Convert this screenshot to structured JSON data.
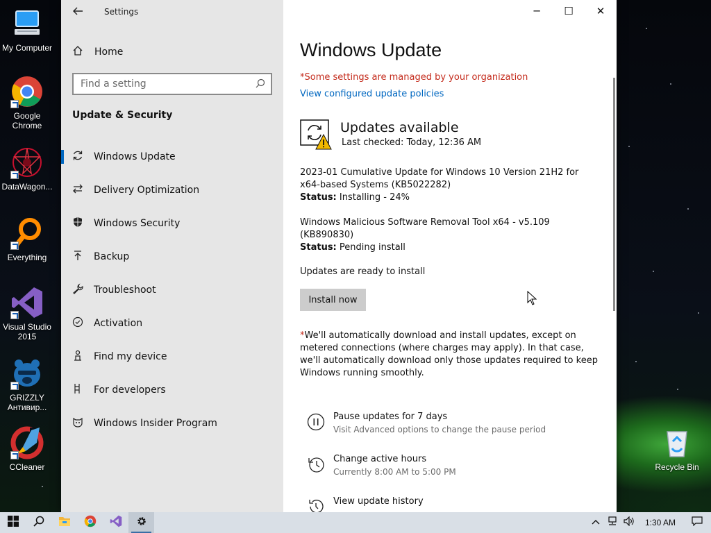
{
  "desktop": {
    "icons": [
      {
        "label": "My Computer",
        "icon": "computer-icon"
      },
      {
        "label": "Google Chrome",
        "icon": "chrome-icon"
      },
      {
        "label": "DataWagon...",
        "icon": "datawagon-icon"
      },
      {
        "label": "Everything",
        "icon": "everything-icon"
      },
      {
        "label": "Visual Studio 2015",
        "icon": "visual-studio-icon"
      },
      {
        "label": "GRIZZLY Антивир...",
        "icon": "grizzly-icon"
      },
      {
        "label": "CCleaner",
        "icon": "ccleaner-icon"
      }
    ],
    "recycle_bin": {
      "label": "Recycle Bin",
      "icon": "recycle-bin-icon"
    }
  },
  "window": {
    "title": "Settings",
    "controls": {
      "minimize": "─",
      "maximize": "☐",
      "close": "✕"
    }
  },
  "sidebar": {
    "home": "Home",
    "search_placeholder": "Find a setting",
    "section": "Update & Security",
    "items": [
      {
        "label": "Windows Update",
        "icon": "sync-icon",
        "active": true
      },
      {
        "label": "Delivery Optimization",
        "icon": "delivery-optimization-icon"
      },
      {
        "label": "Windows Security",
        "icon": "shield-icon"
      },
      {
        "label": "Backup",
        "icon": "backup-icon"
      },
      {
        "label": "Troubleshoot",
        "icon": "wrench-icon"
      },
      {
        "label": "Activation",
        "icon": "check-circle-icon"
      },
      {
        "label": "Find my device",
        "icon": "person-pin-icon"
      },
      {
        "label": "For developers",
        "icon": "developer-icon"
      },
      {
        "label": "Windows Insider Program",
        "icon": "insider-cat-icon"
      }
    ]
  },
  "main": {
    "title": "Windows Update",
    "managed_notice": "*Some settings are managed by your organization",
    "policies_link": "View configured update policies",
    "status_heading": "Updates available",
    "last_checked": "Last checked: Today, 12:36 AM",
    "updates": [
      {
        "name": "2023-01 Cumulative Update for Windows 10 Version 21H2 for x64-based Systems (KB5022282)",
        "status_label": "Status:",
        "status": "Installing - 24%"
      },
      {
        "name": "Windows Malicious Software Removal Tool x64 - v5.109 (KB890830)",
        "status_label": "Status:",
        "status": "Pending install"
      }
    ],
    "ready_text": "Updates are ready to install",
    "install_button": "Install now",
    "auto_note_asterisk": "*",
    "auto_note": "We'll automatically download and install updates, except on metered connections (where charges may apply). In that case, we'll automatically download only those updates required to keep Windows running smoothly.",
    "options": [
      {
        "title": "Pause updates for 7 days",
        "subtitle": "Visit Advanced options to change the pause period",
        "icon": "pause-icon"
      },
      {
        "title": "Change active hours",
        "subtitle": "Currently 8:00 AM to 5:00 PM",
        "icon": "active-hours-icon"
      },
      {
        "title": "View update history",
        "subtitle": "",
        "icon": "history-icon"
      }
    ]
  },
  "taskbar": {
    "items": [
      "start-icon",
      "search-icon",
      "file-explorer-icon",
      "chrome-icon",
      "visual-studio-icon",
      "settings-gear-icon"
    ],
    "clock": "1:30 AM"
  },
  "colors": {
    "accent": "#0067c0",
    "warning_text": "#c42b1c",
    "sidebar_bg": "#e6e6e6",
    "taskbar_bg": "#d9dfe6"
  }
}
